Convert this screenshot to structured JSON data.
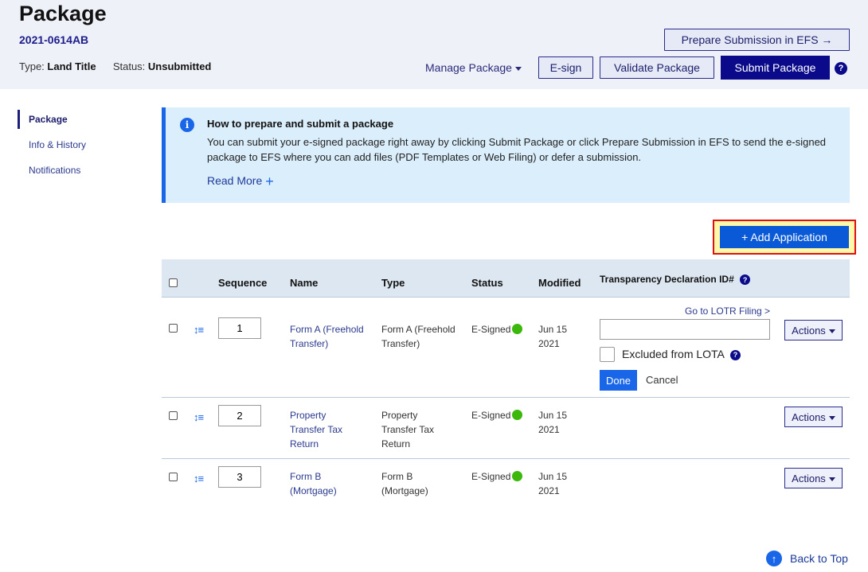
{
  "header": {
    "title": "Package",
    "package_id": "2021-0614AB",
    "type_label": "Type:",
    "type_value": "Land Title",
    "status_label": "Status:",
    "status_value": "Unsubmitted",
    "prepare_submission_label": "Prepare Submission in EFS →",
    "manage_package_label": "Manage Package",
    "esign_label": "E-sign",
    "validate_label": "Validate Package",
    "submit_label": "Submit Package",
    "help_glyph": "?"
  },
  "sidebar": {
    "items": [
      {
        "label": "Package",
        "active": true
      },
      {
        "label": "Info & History",
        "active": false
      },
      {
        "label": "Notifications",
        "active": false
      }
    ]
  },
  "alert": {
    "icon_glyph": "i",
    "title": "How to prepare and submit a package",
    "body": "You can submit your e-signed package right away by clicking Submit Package or click Prepare Submission in EFS to send the e-signed package to EFS where you can add files (PDF Templates or Web Filing) or defer a submission.",
    "read_more_label": "Read More",
    "read_more_glyph": "+",
    "accent_color": "#1a66e8"
  },
  "add_application_label": "+ Add Application",
  "table": {
    "headers": {
      "sequence": "Sequence",
      "name": "Name",
      "type": "Type",
      "status": "Status",
      "modified": "Modified",
      "tdid": "Transparency Declaration ID#"
    },
    "reorder_glyph": "↕≡",
    "actions_label": "Actions",
    "rows": [
      {
        "sequence": "1",
        "name": "Form A (Freehold Transfer)",
        "type": "Form A (Freehold Transfer)",
        "status": "E-Signed",
        "modified_line1": "Jun 15",
        "modified_line2": "2021"
      },
      {
        "sequence": "2",
        "name": "Property Transfer Tax Return",
        "type": "Property Transfer Tax Return",
        "status": "E-Signed",
        "modified_line1": "Jun 15",
        "modified_line2": "2021"
      },
      {
        "sequence": "3",
        "name": "Form B (Mortgage)",
        "type": "Form B (Mortgage)",
        "status": "E-Signed",
        "modified_line1": "Jun 15",
        "modified_line2": "2021"
      }
    ],
    "tdid_editor": {
      "lotr_link": "Go to LOTR Filing >",
      "input_value": "",
      "excluded_label": "Excluded from LOTA",
      "done_label": "Done",
      "cancel_label": "Cancel"
    },
    "status_color": "#3cb80a"
  },
  "back_to_top_label": "Back to Top",
  "back_to_top_glyph": "↑"
}
